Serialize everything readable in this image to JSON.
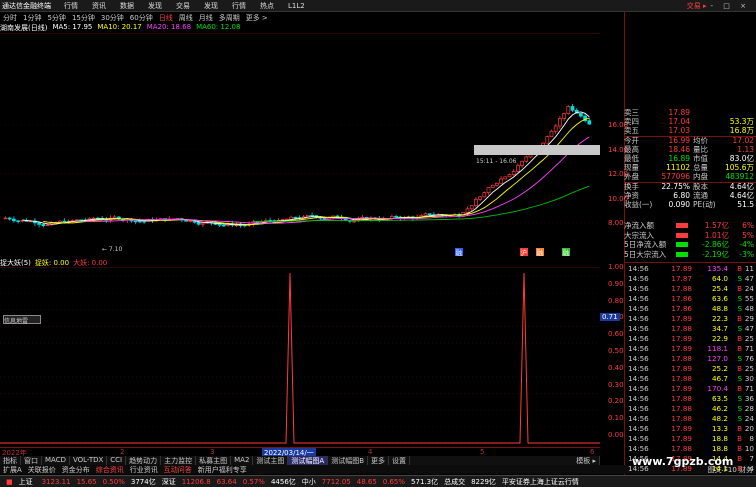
{
  "menubar": {
    "brand": "通达信金融终端",
    "items": [
      "行情",
      "资讯",
      "数据",
      "发现",
      "交易",
      "发现",
      "行情",
      "热点",
      "L1L2"
    ],
    "trade": "交易 ▸",
    "winbtns": "- □ ×"
  },
  "periods": [
    "分时",
    "1分钟",
    "5分钟",
    "15分钟",
    "30分钟",
    "60分钟",
    "日线",
    "周线",
    "月线",
    "多周期",
    "更多 >"
  ],
  "period_selected": 6,
  "ma_legend": {
    "stock": "湖南发展(日线)",
    "ma5": "MA5: 17.95",
    "ma10": "MA10: 20.17",
    "ma20": "MA20: 18.68",
    "ma60": "MA60: 12.08"
  },
  "price_axis": [
    "16.00",
    "14.00",
    "12.00",
    "10.00",
    "8.00"
  ],
  "hover_label": "15:11 - 16.06",
  "chart_marks": {
    "low_label": "7.10",
    "tags": [
      "融",
      "沪",
      "融",
      "融"
    ]
  },
  "ind_legend": {
    "name": "捉大妖(5)",
    "l1": "捉妖: 0.00",
    "l2": "大妖: 0.00"
  },
  "ind_axis": [
    "1.00",
    "0.90",
    "0.80",
    "0.70",
    "0.60",
    "0.50",
    "0.40",
    "0.30",
    "0.20",
    "0.10",
    "0.00"
  ],
  "ind_value": "0.71",
  "info_button": "信息地雷",
  "xaxis": {
    "labels": [
      "2022年",
      "2",
      "3",
      "2022/03/14/一",
      "4",
      "5",
      "6"
    ]
  },
  "quote": {
    "rows": [
      {
        "l": "卖三",
        "p": "17.89",
        "v": "",
        "pc": "red"
      },
      {
        "l": "卖四",
        "p": "17.04",
        "v": "53.3万",
        "pc": "red"
      },
      {
        "l": "卖五",
        "p": "17.03",
        "v": "16.8万",
        "pc": "red"
      }
    ],
    "stats": [
      {
        "a": "今开",
        "av": "16.99",
        "ac": "red",
        "b": "均价",
        "bv": "17.02",
        "bc": "red"
      },
      {
        "a": "最高",
        "av": "18.46",
        "ac": "red",
        "b": "量比",
        "bv": "1.13",
        "bc": "red"
      },
      {
        "a": "最低",
        "av": "16.89",
        "ac": "green",
        "b": "市值",
        "bv": "83.0亿",
        "bc": "white"
      },
      {
        "a": "现量",
        "av": "11102",
        "ac": "yellow",
        "b": "总量",
        "bv": "105.6万",
        "bc": "yellow"
      },
      {
        "a": "外盘",
        "av": "577096",
        "ac": "red",
        "b": "内盘",
        "bv": "483912",
        "bc": "green"
      },
      {
        "a": "换手",
        "av": "22.75%",
        "ac": "white",
        "b": "股本",
        "bv": "4.64亿",
        "bc": "white"
      },
      {
        "a": "净资",
        "av": "6.80",
        "ac": "white",
        "b": "流通",
        "bv": "4.64亿",
        "bc": "white"
      },
      {
        "a": "收益(一)",
        "av": "0.090",
        "ac": "white",
        "b": "PE(动)",
        "bv": "51.5",
        "bc": "white"
      }
    ]
  },
  "flows": [
    {
      "l": "净流入额",
      "v": "1.57亿",
      "p": "6%",
      "c": "red"
    },
    {
      "l": "大宗流入",
      "v": "1.01亿",
      "p": "5%",
      "c": "red"
    },
    {
      "l": "5日净流入额",
      "v": "-2.86亿",
      "p": "-4%",
      "c": "green"
    },
    {
      "l": "5日大宗流入",
      "v": "-2.19亿",
      "p": "-3%",
      "c": "green"
    }
  ],
  "ticks": [
    {
      "t": "14:56",
      "p": "17.89",
      "v": "135.4",
      "bs": "B",
      "s": "11"
    },
    {
      "t": "14:56",
      "p": "17.87",
      "v": "64.0",
      "bs": "S",
      "s": "47"
    },
    {
      "t": "14:56",
      "p": "17.88",
      "v": "25.4",
      "bs": "B",
      "s": "24"
    },
    {
      "t": "14:56",
      "p": "17.86",
      "v": "63.6",
      "bs": "S",
      "s": "55"
    },
    {
      "t": "14:56",
      "p": "17.86",
      "v": "48.8",
      "bs": "S",
      "s": "48"
    },
    {
      "t": "14:56",
      "p": "17.89",
      "v": "22.3",
      "bs": "B",
      "s": "29"
    },
    {
      "t": "14:56",
      "p": "17.88",
      "v": "34.7",
      "bs": "S",
      "s": "47"
    },
    {
      "t": "14:56",
      "p": "17.89",
      "v": "22.9",
      "bs": "B",
      "s": "25"
    },
    {
      "t": "14:56",
      "p": "17.89",
      "v": "118.1",
      "bs": "B",
      "s": "71"
    },
    {
      "t": "14:56",
      "p": "17.88",
      "v": "127.0",
      "bs": "S",
      "s": "76"
    },
    {
      "t": "14:56",
      "p": "17.89",
      "v": "25.2",
      "bs": "B",
      "s": "25"
    },
    {
      "t": "14:56",
      "p": "17.88",
      "v": "46.7",
      "bs": "S",
      "s": "30"
    },
    {
      "t": "14:56",
      "p": "17.89",
      "v": "170.4",
      "bs": "B",
      "s": "71"
    },
    {
      "t": "14:56",
      "p": "17.88",
      "v": "63.5",
      "bs": "S",
      "s": "36"
    },
    {
      "t": "14:56",
      "p": "17.88",
      "v": "46.2",
      "bs": "S",
      "s": "28"
    },
    {
      "t": "14:56",
      "p": "17.88",
      "v": "48.2",
      "bs": "S",
      "s": "24"
    },
    {
      "t": "14:56",
      "p": "17.89",
      "v": "13.3",
      "bs": "B",
      "s": "20"
    },
    {
      "t": "14:56",
      "p": "17.89",
      "v": "18.8",
      "bs": "B",
      "s": "8"
    },
    {
      "t": "14:56",
      "p": "17.88",
      "v": "18.8",
      "bs": "B",
      "s": "10"
    },
    {
      "t": "14:56",
      "p": "17.89",
      "v": "14.4",
      "bs": "B",
      "s": "7"
    },
    {
      "t": "14:56",
      "p": "17.89",
      "v": "14.1",
      "bs": "B",
      "s": "4"
    }
  ],
  "tabs": [
    "指标",
    "窗口",
    "MACD",
    "VOL-TDX",
    "CCI",
    "趋势动力",
    "主力监控",
    "私募主图",
    "MA2",
    "测试主图",
    "测试幅图A",
    "测试幅图B",
    "更多",
    "设置"
  ],
  "tabs_selected": 10,
  "tabs_right": "模板 ▸",
  "tabs2": [
    "扩展A",
    "关联报价",
    "资金分布",
    "综合资讯",
    "行业资讯",
    "互动问答",
    "新用户福利专享"
  ],
  "tabs2_right": "图文 F10 财务",
  "statusbar": {
    "sh_label": "上证",
    "sh_val": "3123.11",
    "sh_chg": "15.65",
    "sh_pct": "0.50%",
    "sh_amt": "3774亿",
    "sz_label": "深证",
    "sz_val": "11206.8",
    "sz_chg": "63.64",
    "sz_pct": "0.57%",
    "sz_amt": "4456亿",
    "zx_label": "中小",
    "zx_val": "7712.05",
    "zx_chg": "48.65",
    "zx_pct": "0.65%",
    "zx_amt": "571.3亿",
    "tot_label": "总成交",
    "tot_val": "8229亿",
    "news": "平安证券上海上证云行情"
  },
  "watermark": "www.7gpzb.com",
  "colors": {
    "up": "#ff3b3b",
    "down": "#00e000",
    "ma5": "#ffffff",
    "ma10": "#ffff00",
    "ma20": "#ff40ff",
    "ma60": "#00e000"
  }
}
